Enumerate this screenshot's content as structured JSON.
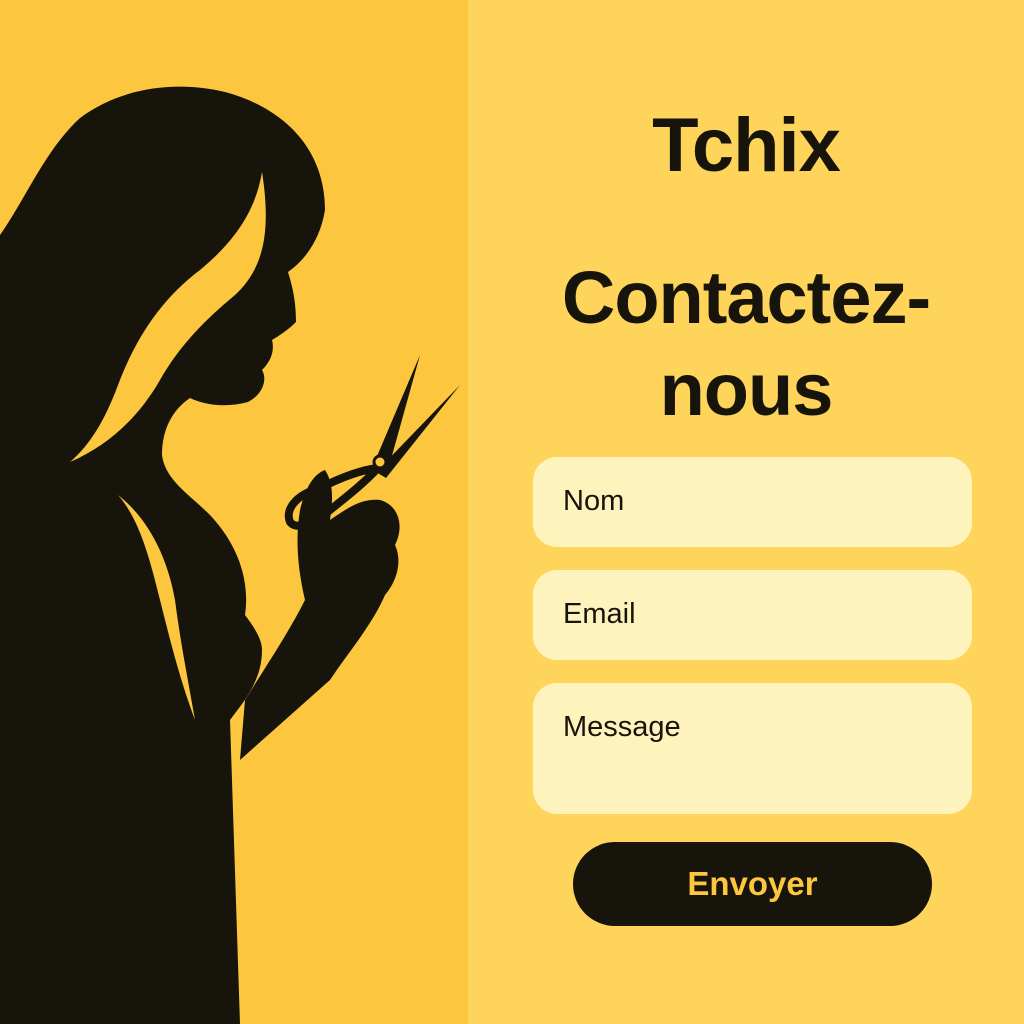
{
  "brand": {
    "name": "Tchix"
  },
  "contact": {
    "heading_line1": "Contactez-",
    "heading_line2": "nous"
  },
  "form": {
    "name_placeholder": "Nom",
    "email_placeholder": "Email",
    "message_placeholder": "Message",
    "submit_label": "Envoyer"
  },
  "illustration": {
    "subject": "hairdresser-silhouette-with-scissors"
  },
  "colors": {
    "left_background": "#fcc63e",
    "right_background": "#fed55a",
    "field_background": "#fff3bd",
    "ink": "#17140b",
    "button_text": "#fcc63e"
  }
}
